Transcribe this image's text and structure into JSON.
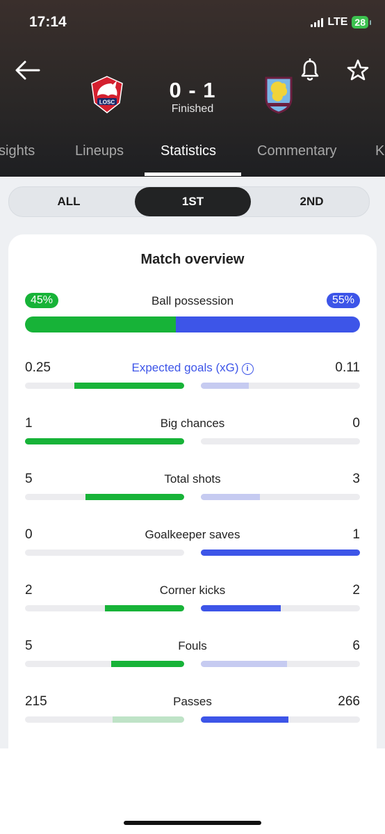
{
  "status_bar": {
    "time": "17:14",
    "network": "LTE",
    "battery": "28"
  },
  "match": {
    "score": "0 - 1",
    "status": "Finished",
    "home_team_crest": "lille-crest",
    "away_team_crest": "aston-villa-crest"
  },
  "tabs": [
    {
      "label": "sights",
      "active": false
    },
    {
      "label": "Lineups",
      "active": false
    },
    {
      "label": "Statistics",
      "active": true
    },
    {
      "label": "Commentary",
      "active": false
    },
    {
      "label": "K",
      "active": false
    }
  ],
  "periods": [
    {
      "label": "ALL",
      "active": false
    },
    {
      "label": "1ST",
      "active": true
    },
    {
      "label": "2ND",
      "active": false
    }
  ],
  "overview": {
    "title": "Match overview",
    "possession": {
      "label": "Ball possession",
      "home": "45%",
      "away": "55%",
      "home_pct": 45,
      "away_pct": 55
    },
    "stats": [
      {
        "label": "Expected goals (xG)",
        "home": "0.25",
        "away": "0.11",
        "home_frac": 0.69,
        "away_frac": 0.3,
        "home_strong": true,
        "away_strong": false
      },
      {
        "label": "Big chances",
        "home": "1",
        "away": "0",
        "home_frac": 1.0,
        "away_frac": 0.0,
        "home_strong": true,
        "away_strong": false
      },
      {
        "label": "Total shots",
        "home": "5",
        "away": "3",
        "home_frac": 0.62,
        "away_frac": 0.37,
        "home_strong": true,
        "away_strong": false
      },
      {
        "label": "Goalkeeper saves",
        "home": "0",
        "away": "1",
        "home_frac": 0.0,
        "away_frac": 1.0,
        "home_strong": false,
        "away_strong": true
      },
      {
        "label": "Corner kicks",
        "home": "2",
        "away": "2",
        "home_frac": 0.5,
        "away_frac": 0.5,
        "home_strong": true,
        "away_strong": true
      },
      {
        "label": "Fouls",
        "home": "5",
        "away": "6",
        "home_frac": 0.46,
        "away_frac": 0.54,
        "home_strong": true,
        "away_strong": false
      },
      {
        "label": "Passes",
        "home": "215",
        "away": "266",
        "home_frac": 0.45,
        "away_frac": 0.55,
        "home_strong": false,
        "away_strong": true
      }
    ]
  },
  "colors": {
    "home_strong": "#17b338",
    "home_weak": "#bfe3c7",
    "away_strong": "#3d55e8",
    "away_weak": "#c6cbf1"
  }
}
